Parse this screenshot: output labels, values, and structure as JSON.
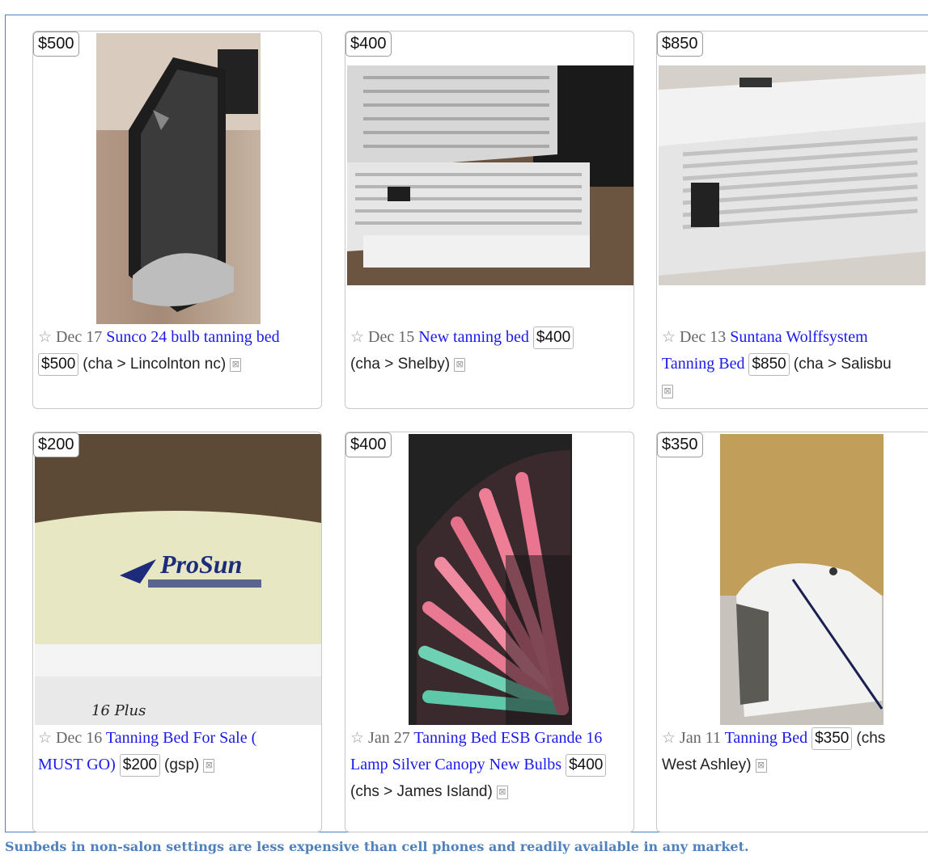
{
  "listings": [
    {
      "badge": "$500",
      "star": "☆",
      "date": "Dec 17",
      "title": "Sunco 24 bulb tanning bed",
      "price": "$500",
      "location": "(cha > Lincolnton nc)",
      "image": "black-tanning-bed-photo"
    },
    {
      "badge": "$400",
      "star": "☆",
      "date": "Dec 15",
      "title": "New tanning bed",
      "price": "$400",
      "location": "(cha > Shelby)",
      "image": "open-white-tanning-bed-photo"
    },
    {
      "badge": "$850",
      "star": "☆",
      "date": "Dec 13",
      "title_a": "Suntana Wolffsystem",
      "title_b": "Tanning Bed",
      "price": "$850",
      "location": "(cha > Salisbu",
      "image": "open-tanning-bed-bulbs-photo"
    },
    {
      "badge": "$200",
      "star": "☆",
      "date": "Dec 16",
      "title_a": "Tanning Bed For Sale (",
      "title_b": "MUST GO)",
      "price": "$200",
      "location": "(gsp)",
      "image": "prosun-tanning-bed-photo",
      "brand_text": "ProSun",
      "handwritten": "16 Plus"
    },
    {
      "badge": "$400",
      "star": "☆",
      "date": "Jan 27",
      "title_a": "Tanning Bed ESB Grande 16",
      "title_b": "Lamp Silver Canopy New Bulbs",
      "price": "$400",
      "location": "(chs > James Island)",
      "image": "lit-canopy-pink-green-photo"
    },
    {
      "badge": "$350",
      "star": "☆",
      "date": "Jan 11",
      "title": "Tanning Bed",
      "price": "$350",
      "location_a": "(chs",
      "location_b": "West Ashley)",
      "image": "white-tanning-bed-photo"
    }
  ],
  "trash_icon": "⊠",
  "caption": "Sunbeds in non-salon settings are less expensive than cell phones and readily available in any market."
}
